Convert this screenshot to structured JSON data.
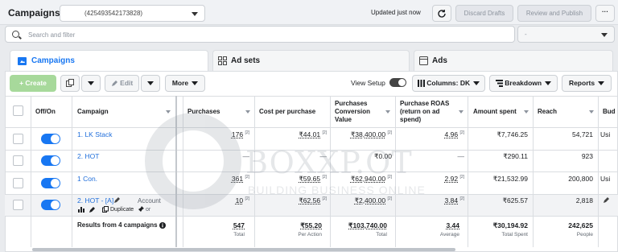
{
  "header": {
    "title": "Campaigns",
    "account": "(425493542173828)",
    "status": "Updated just now",
    "discard_label": "Discard Drafts",
    "publish_label": "Review and Publish",
    "more_label": "···"
  },
  "search": {
    "placeholder": "Search and filter",
    "filter_value": "-"
  },
  "tabs": [
    {
      "label": "Campaigns",
      "icon": "folder-icon"
    },
    {
      "label": "Ad sets",
      "icon": "grid-icon"
    },
    {
      "label": "Ads",
      "icon": "square-icon"
    }
  ],
  "toolbar": {
    "create": "+ Create",
    "edit": "Edit",
    "more": "More",
    "view_setup": "View Setup",
    "columns": "Columns: DK",
    "breakdown": "Breakdown",
    "reports": "Reports"
  },
  "columns": {
    "off_on": "Off/On",
    "campaign": "Campaign",
    "purchases": "Purchases",
    "cost_per_purchase": "Cost per purchase",
    "conversion_value": [
      "Purchases",
      "Conversion",
      "Value"
    ],
    "roas": [
      "Purchase ROAS",
      "(return on ad",
      "spend)"
    ],
    "amount_spent": "Amount spent",
    "reach": "Reach",
    "budget": "Bud"
  },
  "rows": [
    {
      "name": "1. LK Stack",
      "purchases": "176",
      "cost": "₹44.01",
      "value": "₹38,400.00",
      "roas": "4.96",
      "spent": "₹7,746.25",
      "reach": "54,721",
      "budget": "Usi"
    },
    {
      "name": "2. HOT",
      "purchases": "—",
      "cost": "—",
      "value": "₹0.00",
      "roas": "—",
      "spent": "₹290.11",
      "reach": "923",
      "budget": ""
    },
    {
      "name": "1 Con.",
      "purchases": "361",
      "cost": "₹59.65",
      "value": "₹62,940.00",
      "roas": "2.92",
      "spent": "₹21,532.99",
      "reach": "200,800",
      "budget": "Usi"
    },
    {
      "name": "2. HOT - [A]",
      "purchases": "10",
      "cost": "₹62.56",
      "value": "₹2,400.00",
      "roas": "3.84",
      "spent": "₹625.57",
      "reach": "2,818",
      "budget": ""
    }
  ],
  "row4_actions": {
    "duplicate": "Duplicate",
    "account": "Account",
    "extra": "or"
  },
  "totals": {
    "label": "Results from 4 campaigns",
    "purchases": "547",
    "purchases_sub": "Total",
    "cost": "₹55.20",
    "cost_sub": "Per Action",
    "value": "₹103,740.00",
    "value_sub": "Total",
    "roas": "3.44",
    "roas_sub": "Average",
    "spent": "₹30,194.92",
    "spent_sub": "Total Spent",
    "reach": "242,625",
    "reach_sub": "People"
  },
  "watermark": {
    "big": "BOXXP.OT",
    "small": "BUILDING BUSINESS ONLINE"
  },
  "colors": {
    "accent": "#1877f2",
    "create_bg": "#a7d99b",
    "link": "#216fdb"
  }
}
